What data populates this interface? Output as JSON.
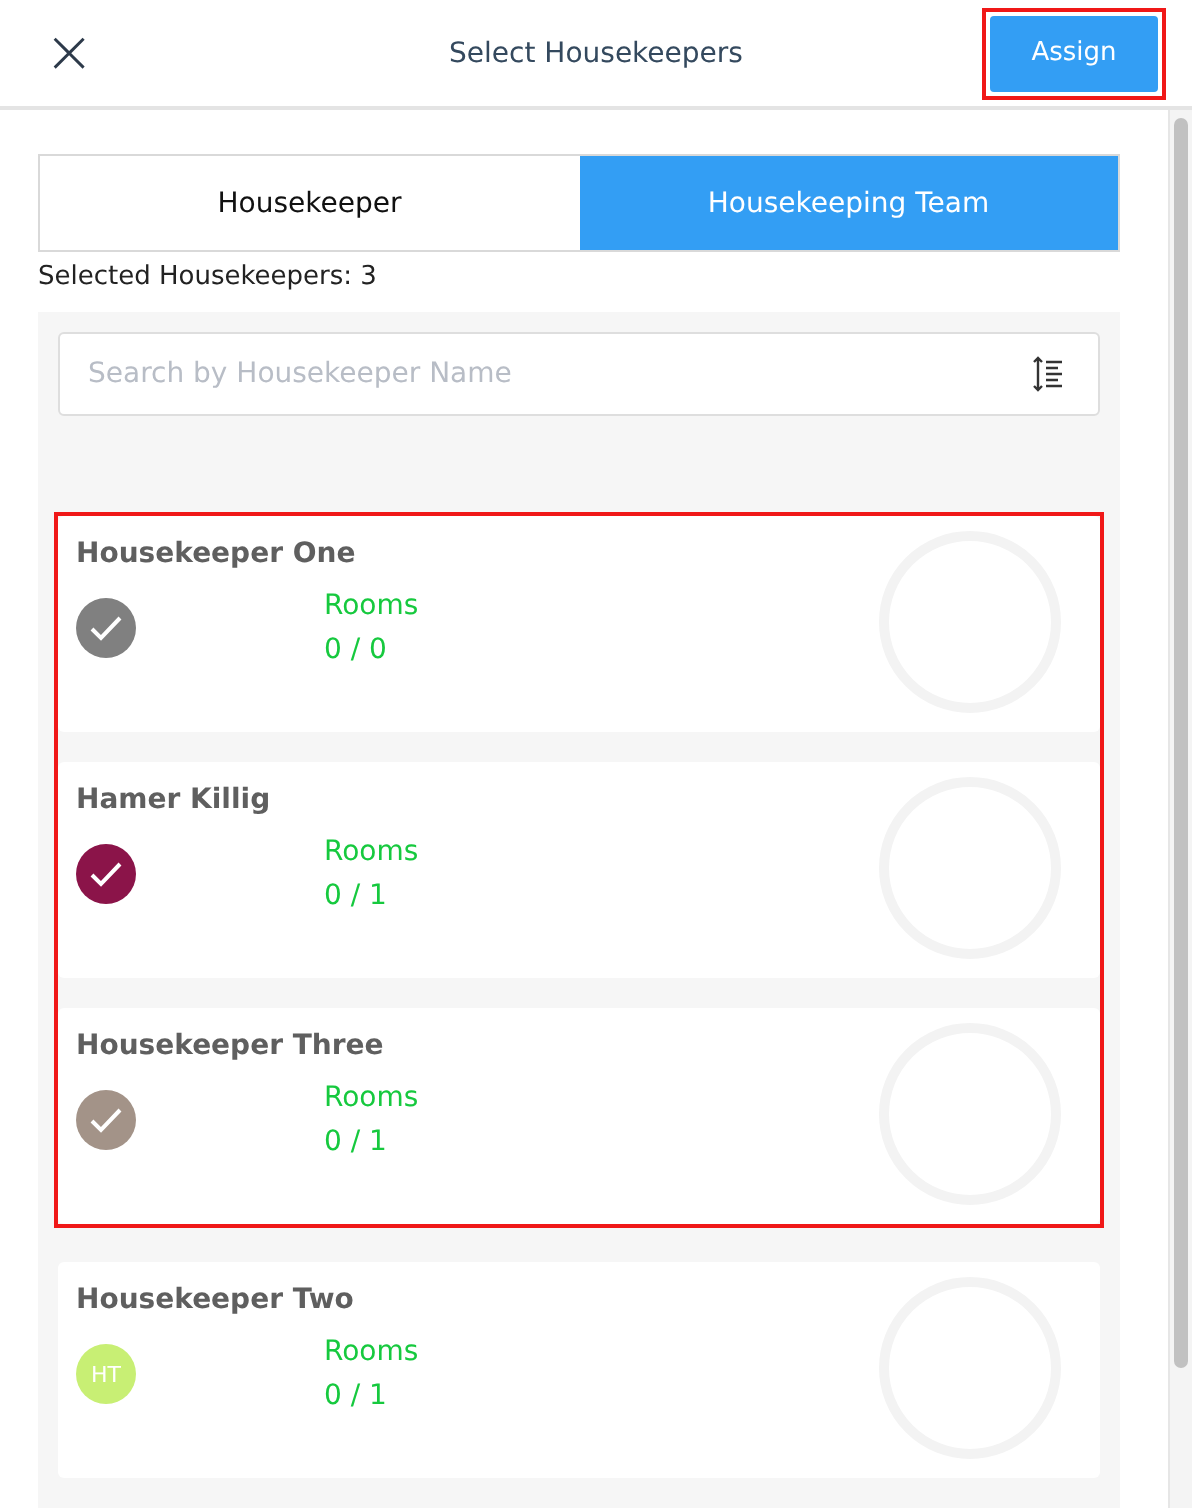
{
  "header": {
    "close": "×",
    "title": "Select Housekeepers",
    "assign": {
      "label": "Assign",
      "highlighted": true
    }
  },
  "tabs": [
    {
      "label": "Housekeeper",
      "selected": false
    },
    {
      "label": "Housekeeping Team",
      "selected": true
    }
  ],
  "selected_count": "Selected Housekeepers: 3",
  "search": {
    "placeholder": "Search by Housekeeper Name"
  },
  "housekeepers": [
    {
      "name": "Housekeeper One",
      "selected": true,
      "color": "#808080",
      "highlighted": true,
      "rooms_label": "Rooms",
      "rooms": "0 / 0"
    },
    {
      "name": "Hamer Killig",
      "selected": true,
      "color": "#8b1449",
      "highlighted": true,
      "rooms_label": "Rooms",
      "rooms": "0 / 1"
    },
    {
      "name": "Housekeeper Three",
      "selected": true,
      "color": "#a39388",
      "highlighted": true,
      "rooms_label": "Rooms",
      "rooms": "0 / 1"
    },
    {
      "name": "Housekeeper Two",
      "selected": false,
      "color": "#c8ef74",
      "initials": "HT",
      "highlighted": false,
      "rooms_label": "Rooms",
      "rooms": "0 / 1"
    }
  ]
}
